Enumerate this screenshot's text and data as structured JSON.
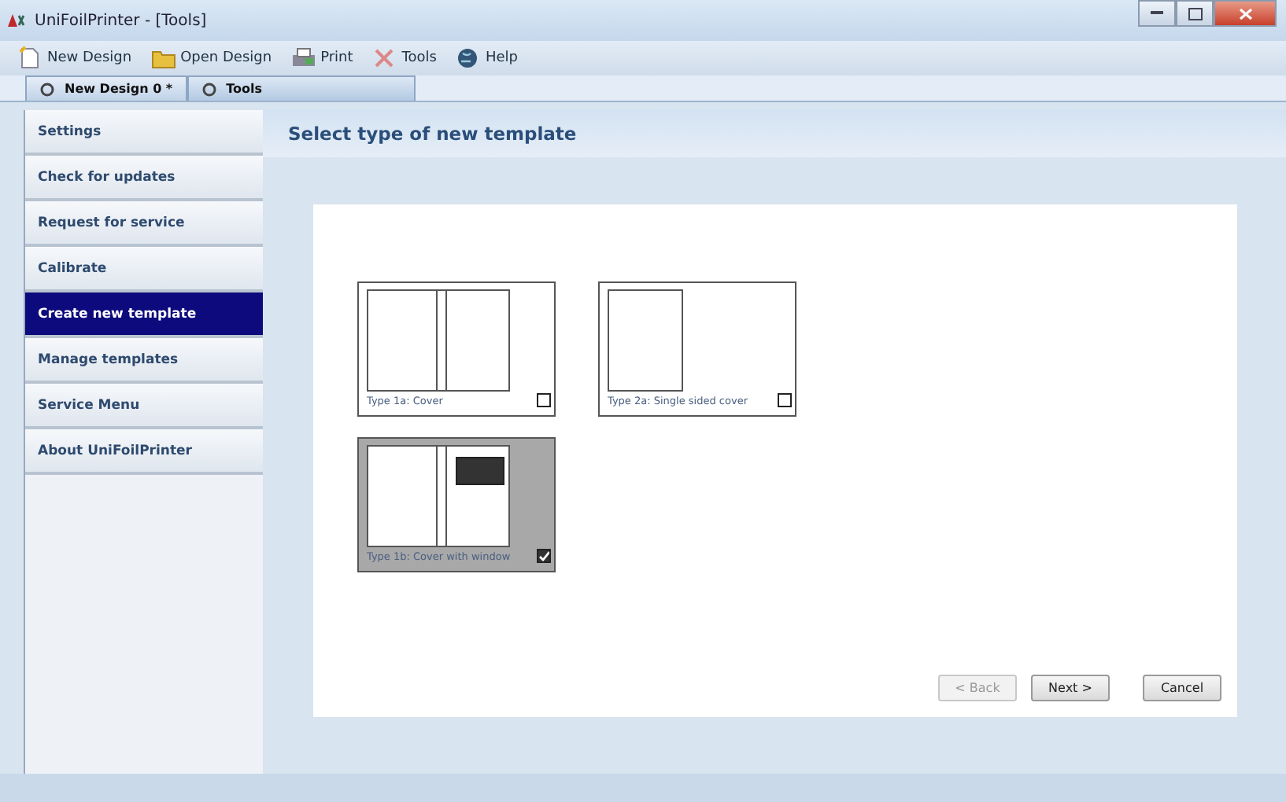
{
  "window": {
    "title": "UniFoilPrinter - [Tools]"
  },
  "toolbar": [
    {
      "label": "New Design",
      "kind": "new"
    },
    {
      "label": "Open Design",
      "kind": "open"
    },
    {
      "label": "Print",
      "kind": "print"
    },
    {
      "label": "Tools",
      "kind": "tools"
    },
    {
      "label": "Help",
      "kind": "help"
    }
  ],
  "tabs": [
    {
      "label": "New Design 0 *",
      "selected": false
    },
    {
      "label": "Tools",
      "selected": true
    }
  ],
  "sidebar": {
    "items": [
      {
        "label": "Settings",
        "selected": false
      },
      {
        "label": "Check for updates",
        "selected": false
      },
      {
        "label": "Request for service",
        "selected": false
      },
      {
        "label": "Calibrate",
        "selected": false
      },
      {
        "label": "Create new template",
        "selected": true
      },
      {
        "label": "Manage templates",
        "selected": false
      },
      {
        "label": "Service Menu",
        "selected": false
      },
      {
        "label": "About UniFoilPrinter",
        "selected": false
      }
    ]
  },
  "header": "Select type of new template",
  "templates": [
    {
      "caption": "Type 1a: Cover",
      "kind": "double",
      "selected": false
    },
    {
      "caption": "Type 2a: Single sided cover",
      "kind": "single",
      "selected": false
    },
    {
      "caption": "Type 1b: Cover with window",
      "kind": "window",
      "selected": true
    }
  ],
  "buttons": [
    {
      "label": "< Back",
      "disabled": true
    },
    {
      "label": "Next >",
      "disabled": false
    },
    {
      "label": "Cancel",
      "disabled": false
    }
  ]
}
